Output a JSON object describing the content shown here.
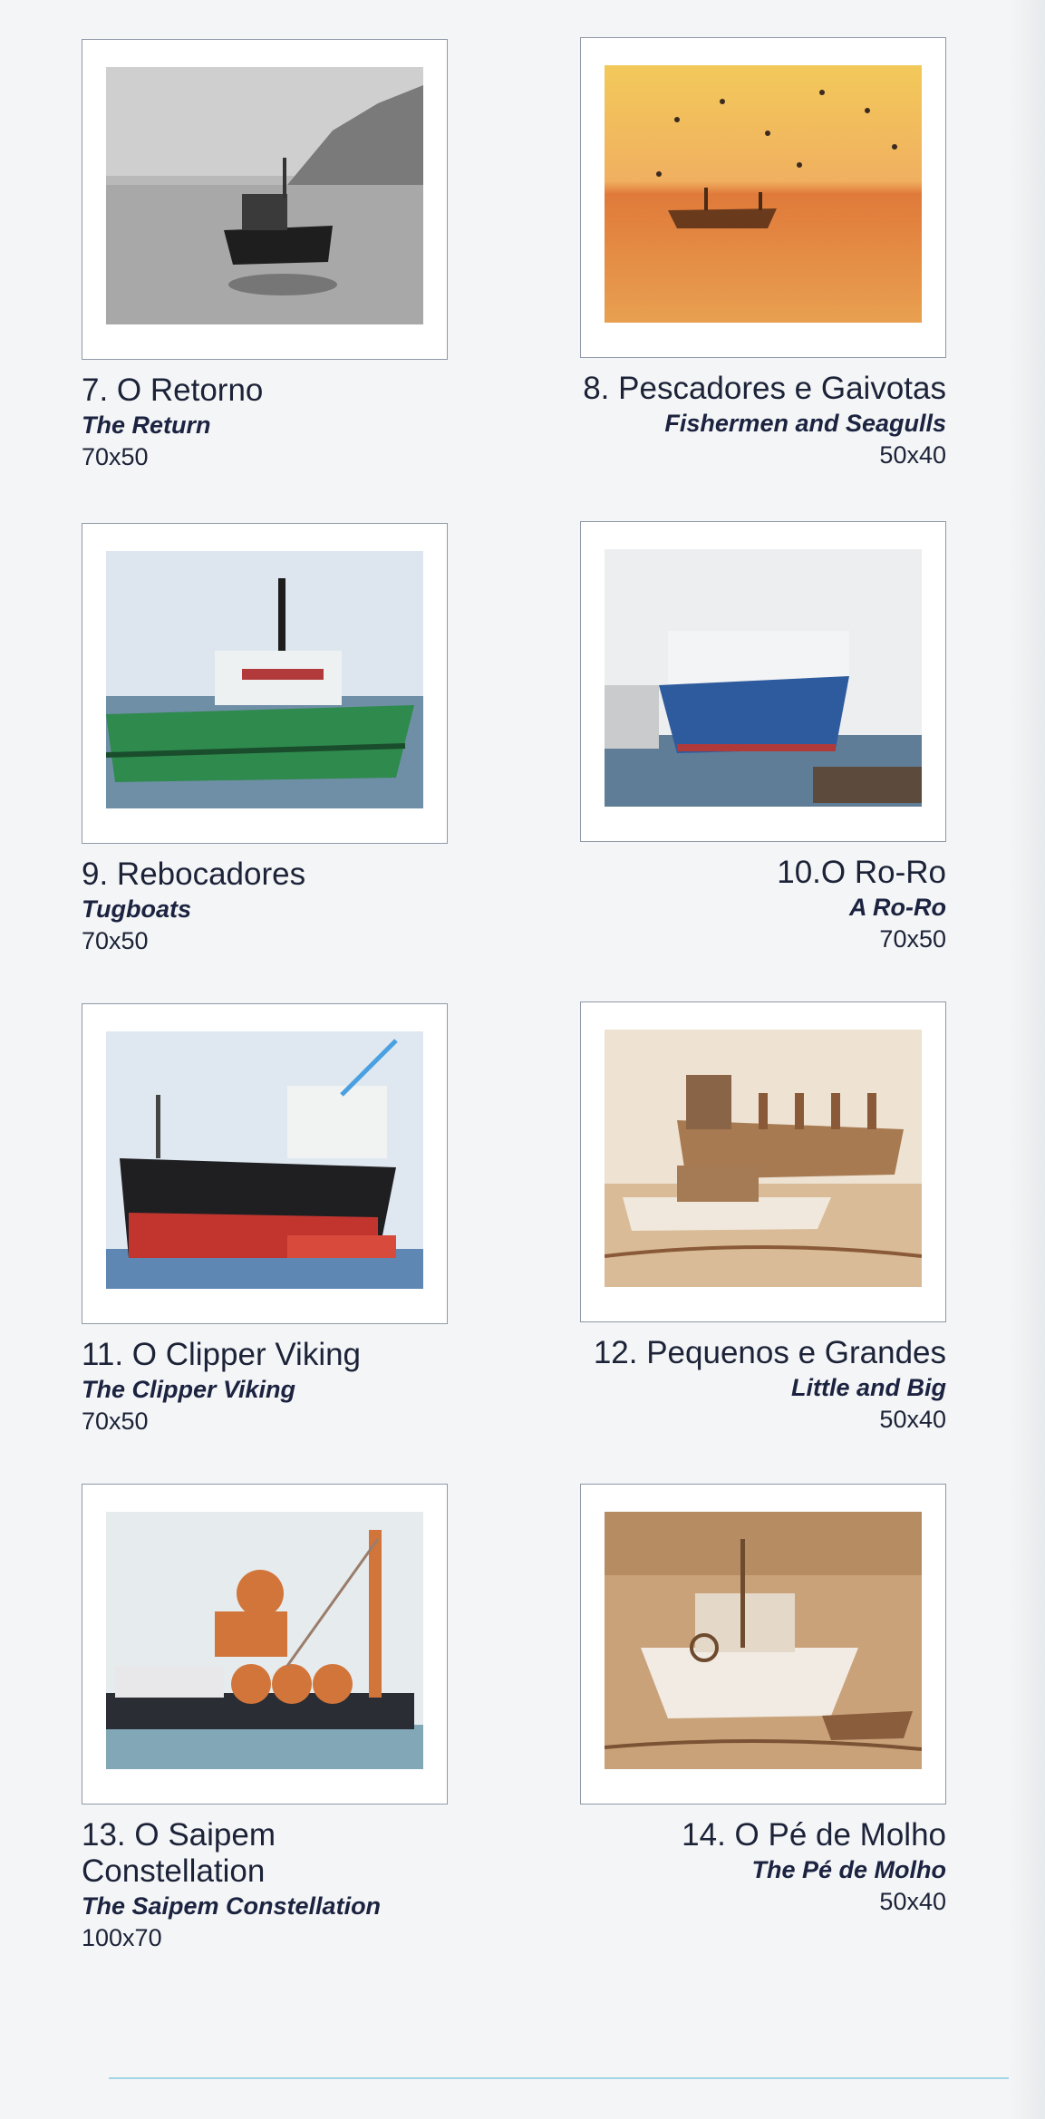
{
  "artworks": [
    {
      "title_pt": "7. O Retorno",
      "title_en": "The Return",
      "size": "70x50",
      "theme": "grayscale"
    },
    {
      "title_pt": "8. Pescadores e Gaivotas",
      "title_en": "Fishermen and Seagulls",
      "size": "50x40",
      "theme": "sunset"
    },
    {
      "title_pt": "9. Rebocadores",
      "title_en": "Tugboats",
      "size": "70x50",
      "theme": "green-tug"
    },
    {
      "title_pt": "10.O Ro-Ro",
      "title_en": "A Ro-Ro",
      "size": "70x50",
      "theme": "blue-ship"
    },
    {
      "title_pt": "11. O Clipper Viking",
      "title_en": "The Clipper Viking",
      "size": "70x50",
      "theme": "red-ship"
    },
    {
      "title_pt": "12. Pequenos e Grandes",
      "title_en": "Little and Big",
      "size": "50x40",
      "theme": "sepia"
    },
    {
      "title_pt": "13. O Saipem Constellation",
      "title_en": "The Saipem Constellation",
      "size": "100x70",
      "theme": "orange-crane"
    },
    {
      "title_pt": "14. O Pé de Molho",
      "title_en": "The Pé de Molho",
      "size": "50x40",
      "theme": "sepia-boat"
    }
  ]
}
